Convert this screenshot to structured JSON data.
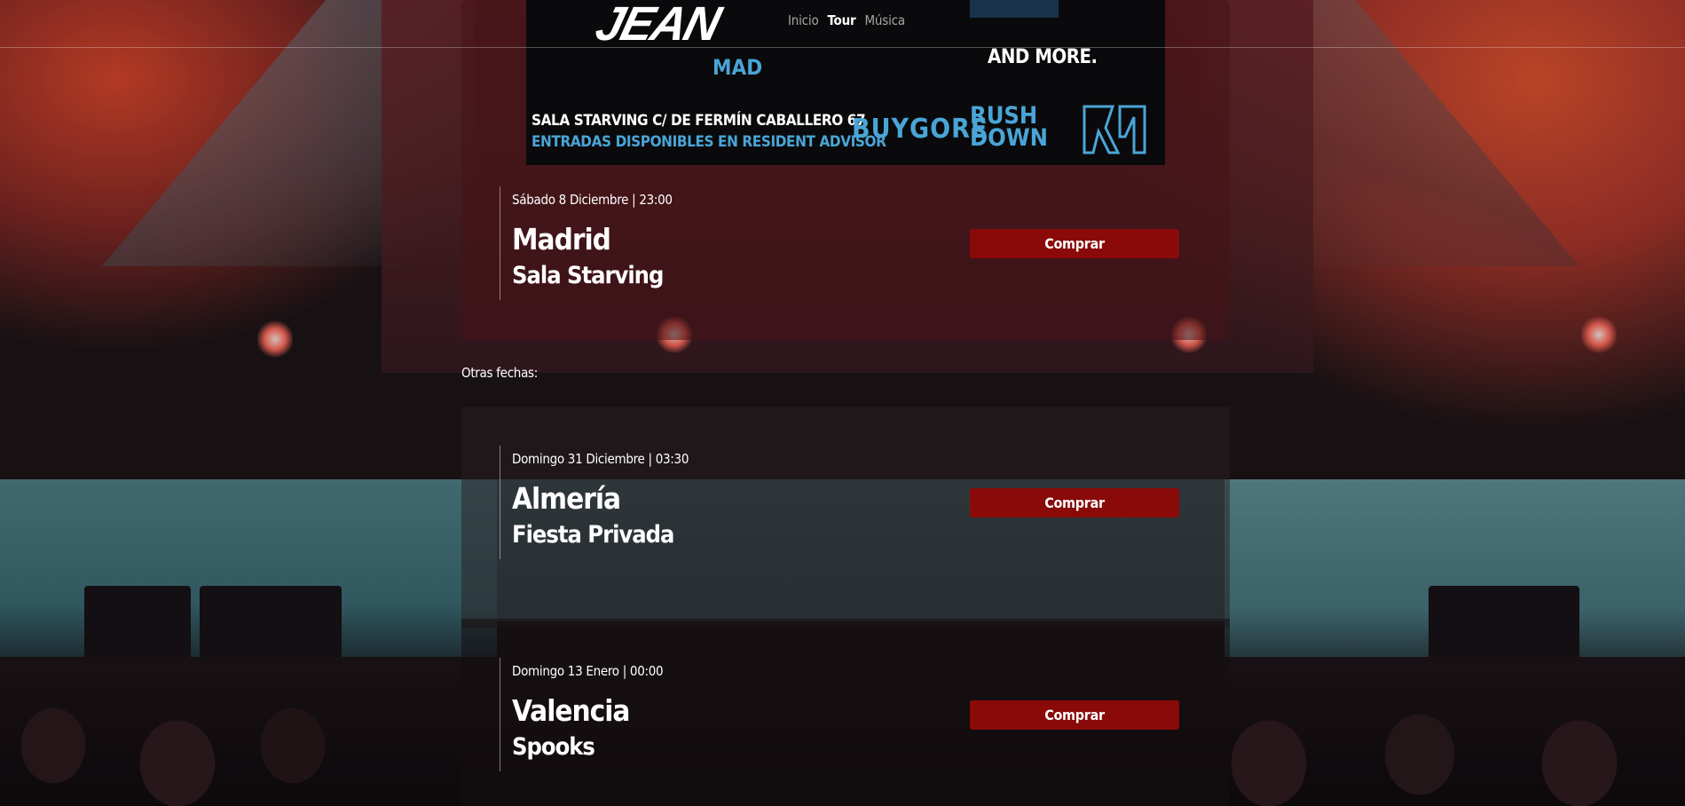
{
  "nav": {
    "items": [
      {
        "label": "Inicio",
        "active": false
      },
      {
        "label": "Tour",
        "active": true
      },
      {
        "label": "Música",
        "active": false
      }
    ]
  },
  "poster": {
    "city": "MAD",
    "and_more": "AND MORE.",
    "venue_line": "SALA STARVING  C/ DE FERMÍN CABALLERO 67",
    "tickets_line": "ENTRADAS DISPONIBLES EN RESIDENT ADVISOR",
    "sponsor_1": "BUYGORE",
    "sponsor_2_line1": "RUSH",
    "sponsor_2_line2": "DOWN",
    "colors": {
      "accent": "#4aa5d6",
      "background": "#0a0a0c"
    }
  },
  "featured_event": {
    "date": "Sábado 8 Diciembre | 23:00",
    "city": "Madrid",
    "venue": "Sala Starving",
    "button_label": "Comprar"
  },
  "other_dates_label": "Otras fechas:",
  "other_events": [
    {
      "date": "Domingo 31 Diciembre | 03:30",
      "city": "Almería",
      "venue": "Fiesta Privada",
      "button_label": "Comprar"
    },
    {
      "date": "Domingo 13 Enero | 00:00",
      "city": "Valencia",
      "venue": "Spooks",
      "button_label": "Comprar"
    }
  ],
  "colors": {
    "button": "#8a0a0a",
    "nav_active": "#ffffff",
    "nav_inactive": "#a9a3a3"
  }
}
